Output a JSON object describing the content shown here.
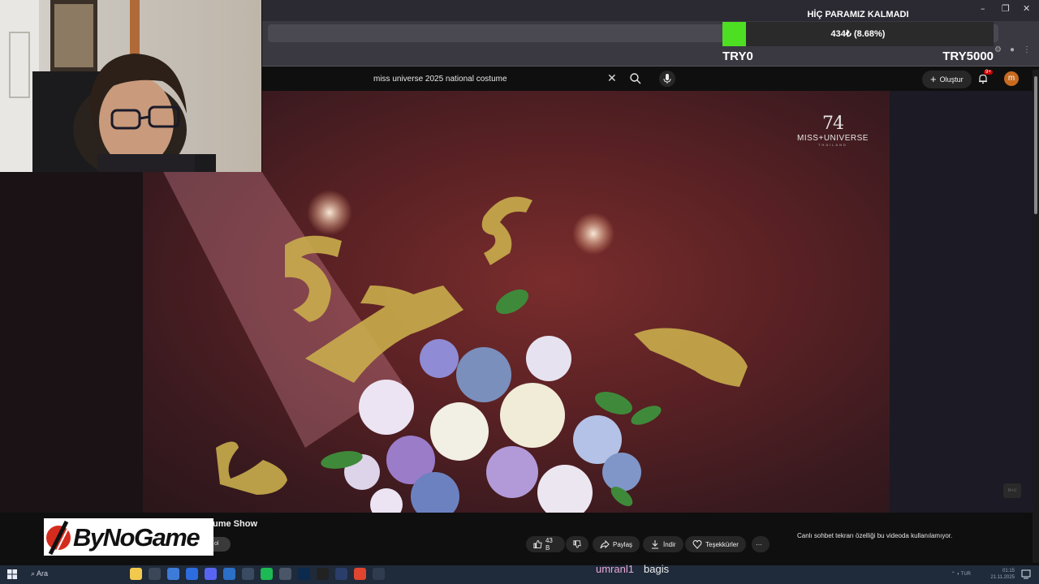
{
  "donation": {
    "title": "HİÇ PARAMIZ KALMADI",
    "progress_text": "434₺ (8.68%)",
    "progress_fraction": 0.0868,
    "min_label": "TRY0",
    "max_label": "TRY5000",
    "fill_color": "#4ddf22"
  },
  "browser": {
    "window_controls": [
      "–",
      "❐",
      "✕"
    ]
  },
  "youtube": {
    "search_value": "miss universe 2025 national costume",
    "create_label": "Oluştur",
    "notification_badge": "9+",
    "avatar_letter": "m"
  },
  "video": {
    "logo_number": "74",
    "logo_text": "MISS+UNIVERSE",
    "logo_sub": "THAILAND",
    "corner_badge": "M+U"
  },
  "below_video": {
    "title_fragment": "ume Show",
    "subscribe_fragment": "ol",
    "actions": {
      "like_count": "43 B",
      "share_label": "Paylaş",
      "download_label": "İndir",
      "thanks_label": "Teşekkürler",
      "more_label": "···"
    },
    "chat_note": "Canlı sohbet tekrarı özelliği bu videoda kullanılamıyor."
  },
  "logo": {
    "brand": "ByNoGame"
  },
  "stream_overlay": {
    "username": "umranl1",
    "action": "bagis"
  },
  "taskbar": {
    "search_label": "Ara",
    "clock_time": "01:15",
    "clock_date": "21.11.2025",
    "lang": "TUR",
    "icons": [
      {
        "name": "copilot-icon",
        "color": "#f2c94c"
      },
      {
        "name": "task-view-icon",
        "color": "#3b4758"
      },
      {
        "name": "browser-icon",
        "color": "#3d7bd9"
      },
      {
        "name": "app-icon",
        "color": "#2d6cdf"
      },
      {
        "name": "discord-icon",
        "color": "#5865f2"
      },
      {
        "name": "store-icon",
        "color": "#2b6fc7"
      },
      {
        "name": "terminal-icon",
        "color": "#3a4a60"
      },
      {
        "name": "spotify-icon",
        "color": "#1db954"
      },
      {
        "name": "editor-icon",
        "color": "#4a5568"
      },
      {
        "name": "photoshop-icon",
        "color": "#0c2a4d"
      },
      {
        "name": "capcut-icon",
        "color": "#222"
      },
      {
        "name": "vs-icon",
        "color": "#2b3d6b"
      },
      {
        "name": "chrome-icon",
        "color": "#e0452f"
      },
      {
        "name": "obs-icon",
        "color": "#2f3c4f"
      }
    ]
  }
}
